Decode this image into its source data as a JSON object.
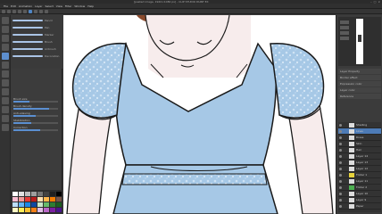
{
  "window": {
    "title": "[pasted image, 1920×1080 px] - CLIP STUDIO PAINT EX",
    "controls": [
      "–",
      "□",
      "×"
    ]
  },
  "menu": {
    "items": [
      "File",
      "Edit",
      "Animation",
      "Layer",
      "Select",
      "View",
      "Filter",
      "Window",
      "Help"
    ]
  },
  "brushes": [
    {
      "label": "Pencil"
    },
    {
      "label": "Pen"
    },
    {
      "label": "Marker"
    },
    {
      "label": "Brush"
    },
    {
      "label": "Airbrush"
    },
    {
      "label": "Decoration"
    }
  ],
  "tool_property": {
    "rows": [
      {
        "label": "Brush size",
        "level": 0.35
      },
      {
        "label": "Brush density",
        "level": 0.8
      },
      {
        "label": "Anti-aliasing",
        "level": 0.5
      },
      {
        "label": "Stabilization",
        "level": 0.4
      },
      {
        "label": "Correction",
        "level": 0.6
      }
    ]
  },
  "palette": {
    "colors": [
      "#ffffff",
      "#e0e0e0",
      "#bdbdbd",
      "#9e9e9e",
      "#757575",
      "#424242",
      "#212121",
      "#000000",
      "#f8bbd0",
      "#ef9a9a",
      "#e53935",
      "#b71c1c",
      "#ffe0b2",
      "#ffb74d",
      "#f57c00",
      "#795548",
      "#bbdefb",
      "#64b5f6",
      "#1e88e5",
      "#0d47a1",
      "#c8e6c9",
      "#66bb6a",
      "#2e7d32",
      "#1b5e20",
      "#fff9c4",
      "#ffee58",
      "#fbc02d",
      "#f57f17",
      "#e1bee7",
      "#ba68c8",
      "#7b1fa2",
      "#4a148c"
    ]
  },
  "right_panel": {
    "tool_rows": [
      "Layer Property",
      "Border effect",
      "Expression color",
      "Layer color",
      "Reference"
    ],
    "layers": [
      {
        "name": "Shading",
        "sel": false,
        "kind": "normal"
      },
      {
        "name": "Lines",
        "sel": true,
        "kind": "normal"
      },
      {
        "name": "Dress",
        "sel": false,
        "kind": "normal"
      },
      {
        "name": "Skin",
        "sel": false,
        "kind": "normal"
      },
      {
        "name": "Hair",
        "sel": false,
        "kind": "normal"
      },
      {
        "name": "Layer 14",
        "sel": false,
        "kind": "normal"
      },
      {
        "name": "Layer 13",
        "sel": false,
        "kind": "normal"
      },
      {
        "name": "Layer 12",
        "sel": false,
        "kind": "normal"
      },
      {
        "name": "Folder 1",
        "sel": false,
        "kind": "yellow"
      },
      {
        "name": "Layer 11",
        "sel": false,
        "kind": "normal"
      },
      {
        "name": "Folder 2",
        "sel": false,
        "kind": "green"
      },
      {
        "name": "Layer 10",
        "sel": false,
        "kind": "normal"
      },
      {
        "name": "Layer 9",
        "sel": false,
        "kind": "normal"
      },
      {
        "name": "Paper",
        "sel": false,
        "kind": "normal"
      }
    ]
  },
  "colors": {
    "dress": "#a6c8e6",
    "dress_pattern": "#c9def2",
    "skin": "#f7ecec",
    "line": "#1a1a1a",
    "hair": "#8a4a2c",
    "accent": "#5b8fd1"
  }
}
